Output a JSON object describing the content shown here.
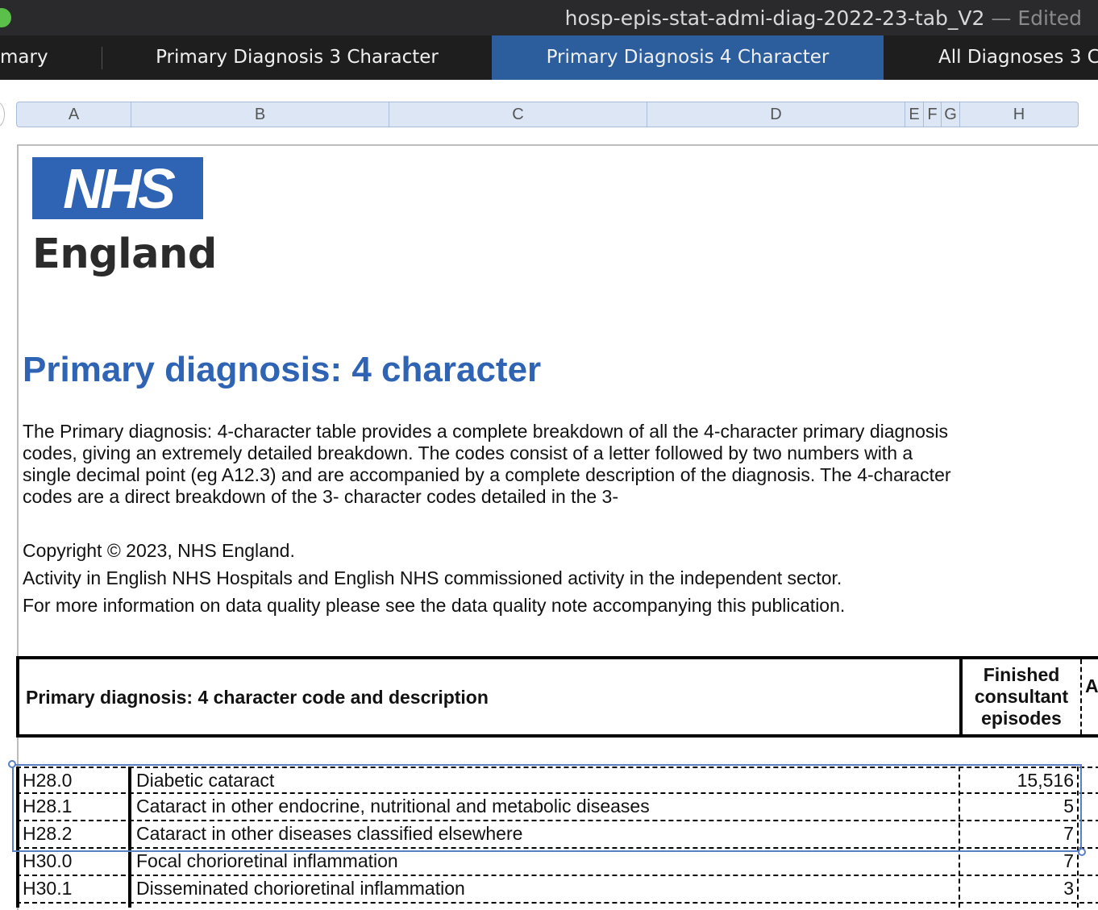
{
  "window": {
    "title": "hosp-epis-stat-admi-diag-2022-23-tab_V2",
    "status": "— Edited"
  },
  "tabs": [
    {
      "label": "mary",
      "active": false
    },
    {
      "label": "Primary Diagnosis 3 Character",
      "active": false
    },
    {
      "label": "Primary Diagnosis 4 Character",
      "active": true
    },
    {
      "label": "All Diagnoses 3 C",
      "active": false
    }
  ],
  "columns": [
    "A",
    "B",
    "C",
    "D",
    "E",
    "F",
    "G",
    "H"
  ],
  "logo": {
    "mark": "NHS",
    "sub": "England"
  },
  "sheet": {
    "title": "Primary diagnosis: 4 character",
    "description": "The Primary diagnosis: 4-character table provides a complete breakdown of all the 4-character primary diagnosis codes, giving an extremely detailed breakdown. The codes consist of a letter followed by two numbers with a single decimal point (eg A12.3) and are accompanied by a complete description of the diagnosis. The 4-character codes are a direct breakdown of the 3- character codes detailed in the 3-",
    "copyright": "Copyright © 2023, NHS England.",
    "activity": "Activity in English NHS Hospitals and English NHS commissioned activity in the independent sector.",
    "quality": "For more information on data quality please see the data quality note accompanying this publication."
  },
  "table": {
    "header_main": "Primary diagnosis: 4 character code and description",
    "header_fce": "Finished consultant episodes",
    "header_next": "A",
    "rows": [
      {
        "code": "H28.0",
        "desc": "Diabetic cataract",
        "fce": "15,516"
      },
      {
        "code": "H28.1",
        "desc": "Cataract in other endocrine, nutritional and metabolic diseases",
        "fce": "5"
      },
      {
        "code": "H28.2",
        "desc": "Cataract in other diseases classified elsewhere",
        "fce": "7"
      },
      {
        "code": "H30.0",
        "desc": "Focal chorioretinal inflammation",
        "fce": "7"
      },
      {
        "code": "H30.1",
        "desc": "Disseminated chorioretinal inflammation",
        "fce": "3"
      }
    ]
  },
  "colors": {
    "accent": "#2f63b4",
    "active_tab": "#2c5d9c",
    "selection": "#5b7fc4"
  }
}
